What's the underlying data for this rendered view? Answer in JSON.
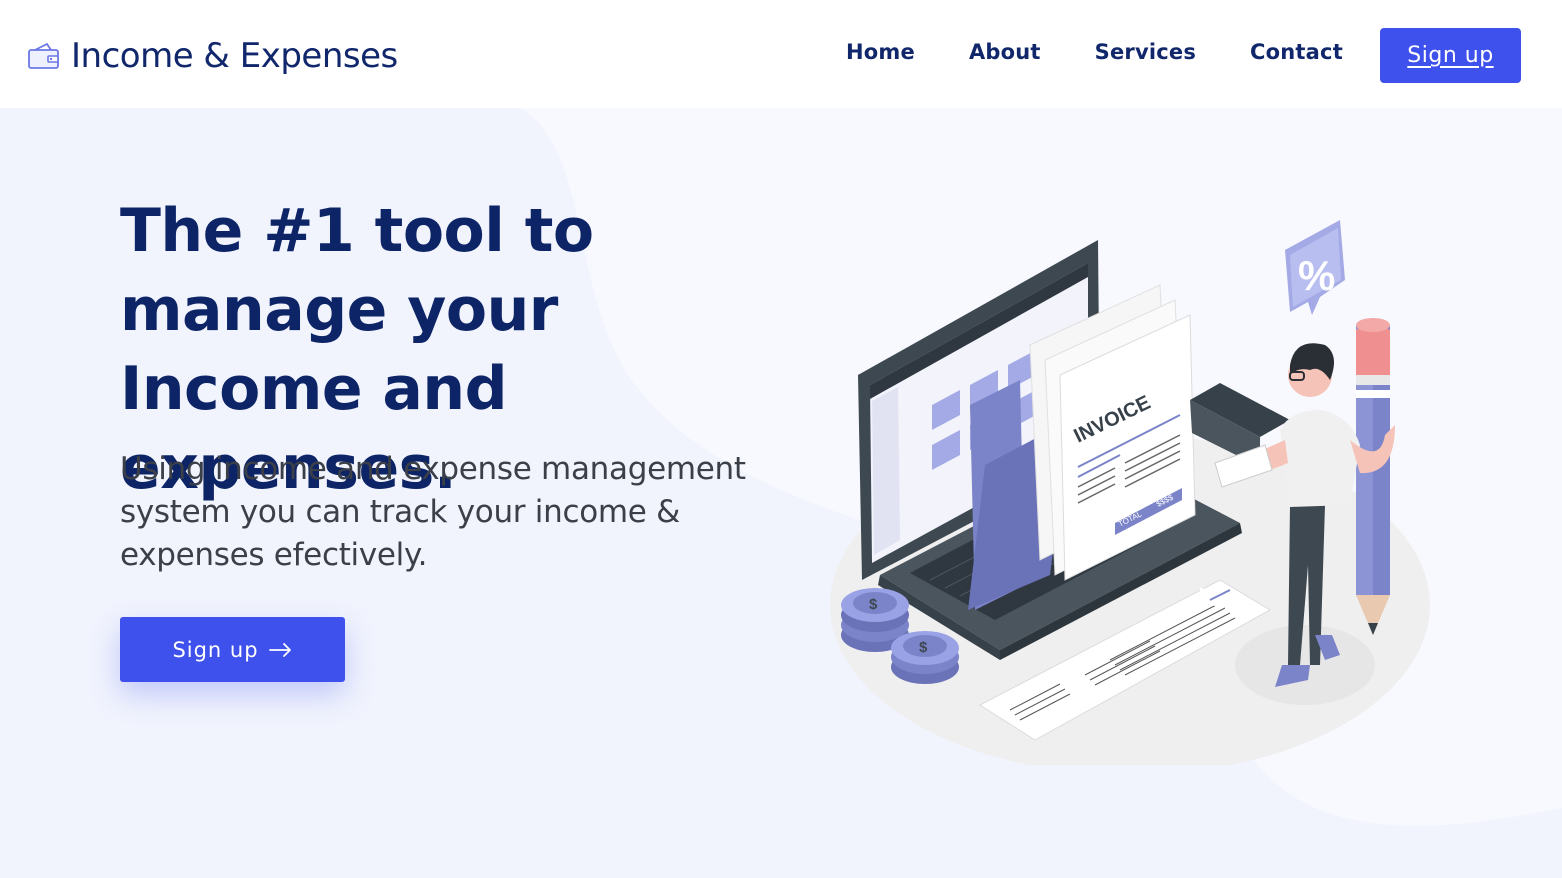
{
  "brand": {
    "title": "Income & Expenses",
    "icon": "wallet-icon"
  },
  "nav": {
    "items": [
      {
        "label": "Home"
      },
      {
        "label": "About"
      },
      {
        "label": "Services"
      },
      {
        "label": "Contact"
      }
    ],
    "signup_label": "Sign up"
  },
  "hero": {
    "title": "The #1 tool to manage your Income and expenses.",
    "subtitle": "Using income and expense management system you can track your income & expenses efectively.",
    "cta_label": "Sign up",
    "cta_icon": "arrow-right-icon"
  },
  "illustration": {
    "invoice_label": "INVOICE",
    "total_label": "TOTAL",
    "total_value": "$$$$",
    "percent_symbol": "%",
    "coin_symbol": "$"
  },
  "colors": {
    "accent": "#3f51ec",
    "heading": "#0d2466",
    "hero_bg": "#f1f4fd",
    "illustration_purple": "#7b84c9"
  }
}
